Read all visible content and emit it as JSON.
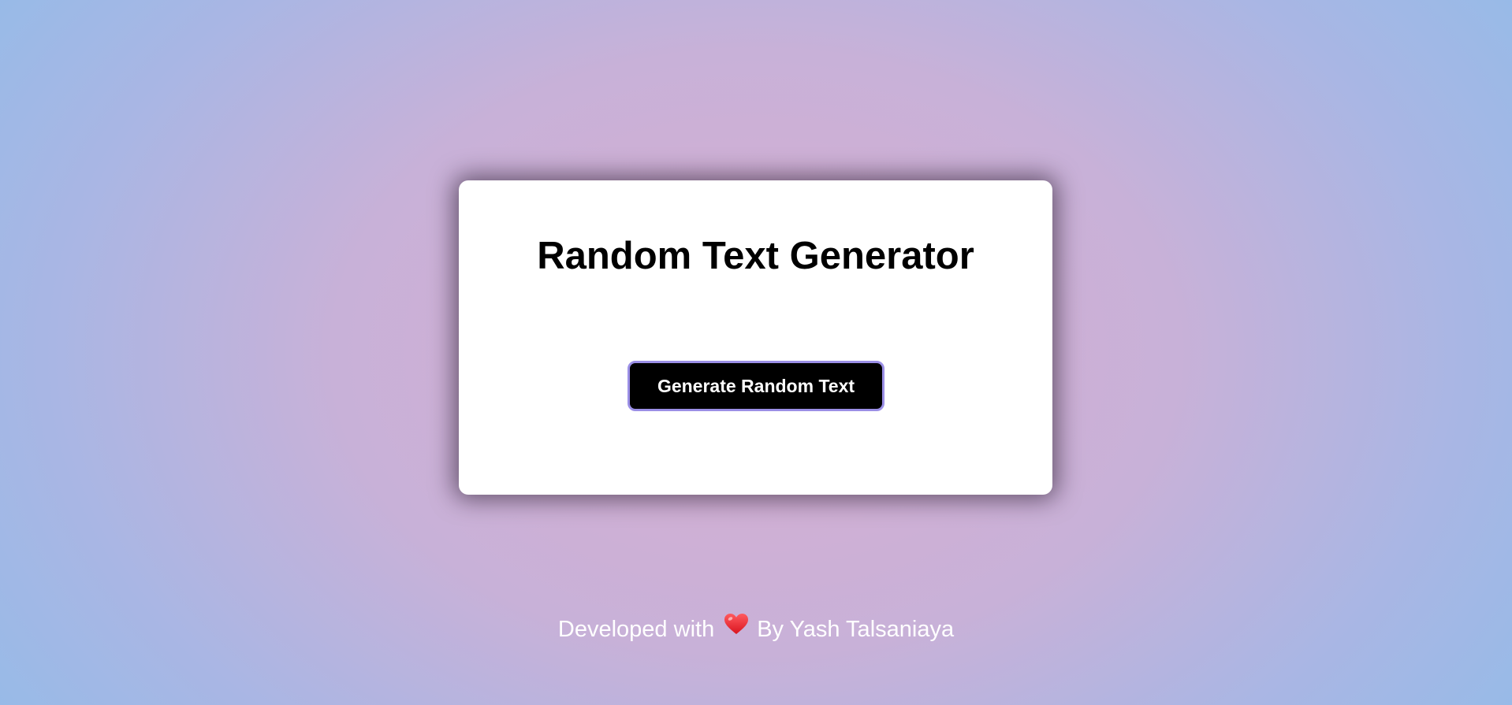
{
  "card": {
    "title": "Random Text Generator",
    "output_text": "",
    "button_label": "Generate Random Text"
  },
  "footer": {
    "prefix": "Developed with",
    "suffix": "By Yash Talsaniaya",
    "icon": "heart-icon"
  },
  "colors": {
    "button_bg": "#000000",
    "button_border": "#9b8fe6",
    "card_bg": "#ffffff",
    "heart": "#e8222f",
    "bg_center": "#d8aed1",
    "bg_edge": "#95bbe8"
  }
}
